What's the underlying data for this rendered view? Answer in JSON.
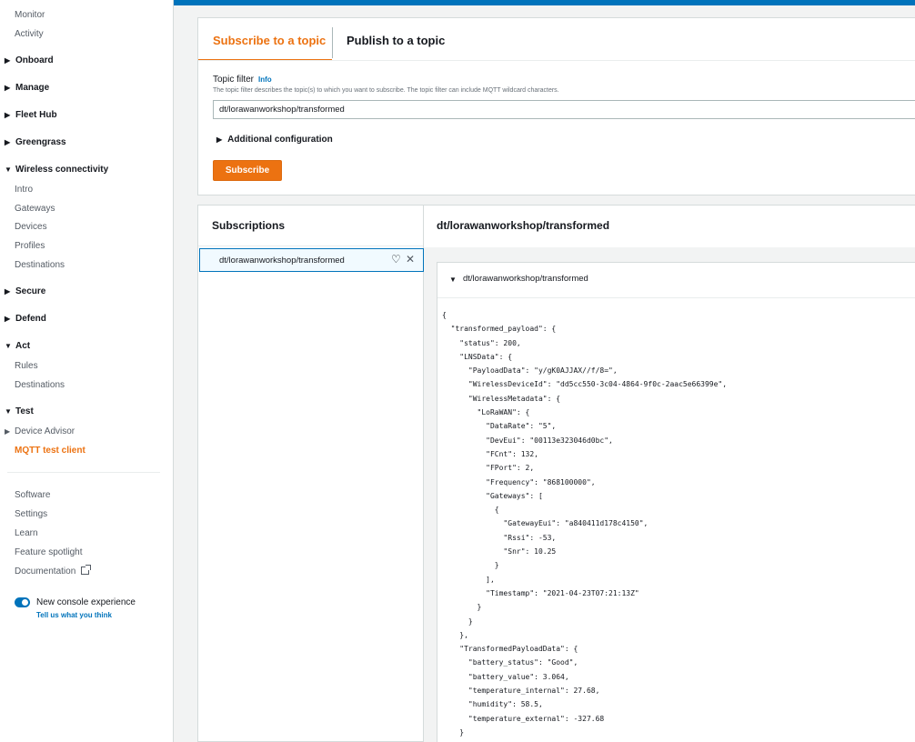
{
  "sidebar": {
    "top_items": [
      "Monitor",
      "Activity"
    ],
    "sections": {
      "onboard": "Onboard",
      "manage": "Manage",
      "fleet_hub": "Fleet Hub",
      "greengrass": "Greengrass",
      "wireless": "Wireless connectivity",
      "secure": "Secure",
      "defend": "Defend",
      "act": "Act",
      "test": "Test"
    },
    "wireless_items": [
      "Intro",
      "Gateways",
      "Devices",
      "Profiles",
      "Destinations"
    ],
    "act_items": [
      "Rules",
      "Destinations"
    ],
    "test_items": [
      "Device Advisor",
      "MQTT test client"
    ],
    "footer_items": [
      "Software",
      "Settings",
      "Learn",
      "Feature spotlight",
      "Documentation"
    ],
    "new_console_label": "New console experience",
    "feedback_link": "Tell us what you think",
    "collapsed_caret": "▶",
    "expanded_caret": "▼"
  },
  "tabs": {
    "subscribe": "Subscribe to a topic",
    "publish": "Publish to a topic"
  },
  "form": {
    "topic_filter_label": "Topic filter",
    "info_link": "Info",
    "description": "The topic filter describes the topic(s) to which you want to subscribe. The topic filter can include MQTT wildcard characters.",
    "topic_value": "dt/lorawanworkshop/transformed",
    "additional_config": "Additional configuration",
    "subscribe_button": "Subscribe"
  },
  "subscriptions": {
    "title": "Subscriptions",
    "items": [
      {
        "name": "dt/lorawanworkshop/transformed"
      }
    ]
  },
  "messages": {
    "header": "dt/lorawanworkshop/transformed",
    "card_topic": "dt/lorawanworkshop/transformed",
    "payload": "{\n  \"transformed_payload\": {\n    \"status\": 200,\n    \"LNSData\": {\n      \"PayloadData\": \"y/gK0AJJAX//f/8=\",\n      \"WirelessDeviceId\": \"dd5cc550-3c04-4864-9f0c-2aac5e66399e\",\n      \"WirelessMetadata\": {\n        \"LoRaWAN\": {\n          \"DataRate\": \"5\",\n          \"DevEui\": \"00113e323046d0bc\",\n          \"FCnt\": 132,\n          \"FPort\": 2,\n          \"Frequency\": \"868100000\",\n          \"Gateways\": [\n            {\n              \"GatewayEui\": \"a840411d178c4150\",\n              \"Rssi\": -53,\n              \"Snr\": 10.25\n            }\n          ],\n          \"Timestamp\": \"2021-04-23T07:21:13Z\"\n        }\n      }\n    },\n    \"TransformedPayloadData\": {\n      \"battery_status\": \"Good\",\n      \"battery_value\": 3.064,\n      \"temperature_internal\": 27.68,\n      \"humidity\": 58.5,\n      \"temperature_external\": -327.68\n    }"
  },
  "colors": {
    "accent": "#ec7211",
    "link": "#0073bb"
  }
}
